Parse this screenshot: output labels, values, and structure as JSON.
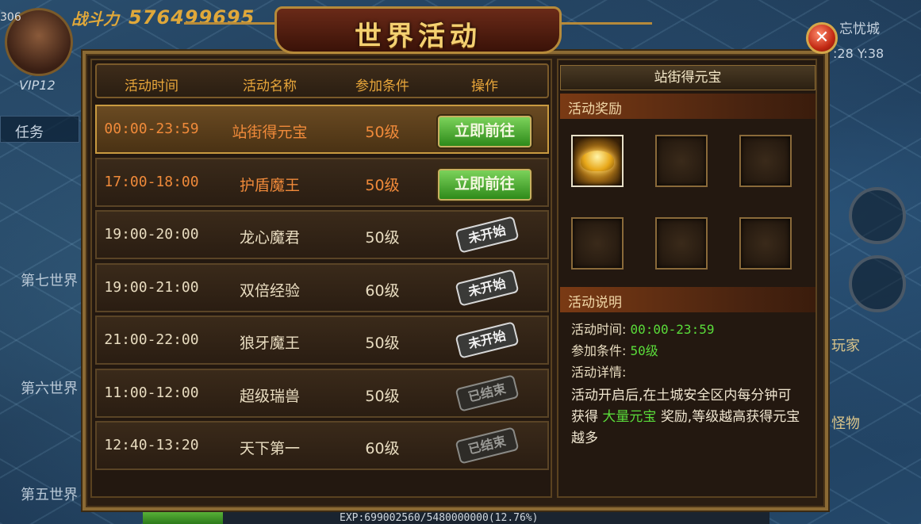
{
  "hud": {
    "level_number": "306",
    "vip": "VIP12",
    "power_label": "战斗力",
    "power_value": "576499695",
    "task_tab": "任务",
    "worlds": [
      "第七世界",
      "第六世界",
      "第五世界"
    ],
    "city": "忘忧城",
    "coords": ":28 Y:38",
    "side_texts": [
      "玩家",
      "怪物"
    ],
    "exp_text": "EXP:699002560/5480000000(12.76%)",
    "exp_fraction": 0.1276
  },
  "dialog": {
    "title": "世界活动",
    "close_icon": "close-icon",
    "close_glyph": "✕",
    "table": {
      "headers": [
        "活动时间",
        "活动名称",
        "参加条件",
        "操作"
      ],
      "rows": [
        {
          "time": "00:00-23:59",
          "name": "站街得元宝",
          "cond": "50级",
          "action": "立即前往",
          "state": "go"
        },
        {
          "time": "17:00-18:00",
          "name": "护盾魔王",
          "cond": "50级",
          "action": "立即前往",
          "state": "go"
        },
        {
          "time": "19:00-20:00",
          "name": "龙心魔君",
          "cond": "50级",
          "action": "未开始",
          "state": "pending"
        },
        {
          "time": "19:00-21:00",
          "name": "双倍经验",
          "cond": "60级",
          "action": "未开始",
          "state": "pending"
        },
        {
          "time": "21:00-22:00",
          "name": "狼牙魔王",
          "cond": "50级",
          "action": "未开始",
          "state": "pending"
        },
        {
          "time": "11:00-12:00",
          "name": "超级瑞兽",
          "cond": "50级",
          "action": "已结束",
          "state": "ended"
        },
        {
          "time": "12:40-13:20",
          "name": "天下第一",
          "cond": "60级",
          "action": "已结束",
          "state": "ended"
        }
      ]
    },
    "detail_panel": {
      "title": "站街得元宝",
      "reward_header": "活动奖励",
      "desc_header": "活动说明",
      "time_label": "活动时间:",
      "time_value": "00:00-23:59",
      "cond_label": "参加条件:",
      "cond_value": "50级",
      "detail_label": "活动详情:",
      "detail_part1": "活动开启后,在土城安全区内每分钟可获得",
      "detail_highlight": "大量元宝",
      "detail_part2": "奖励,等级越高获得元宝越多"
    }
  },
  "colors": {
    "accent_gold": "#e8a63a",
    "active_orange": "#f08a3a",
    "highlight_green": "#5adc3a"
  }
}
